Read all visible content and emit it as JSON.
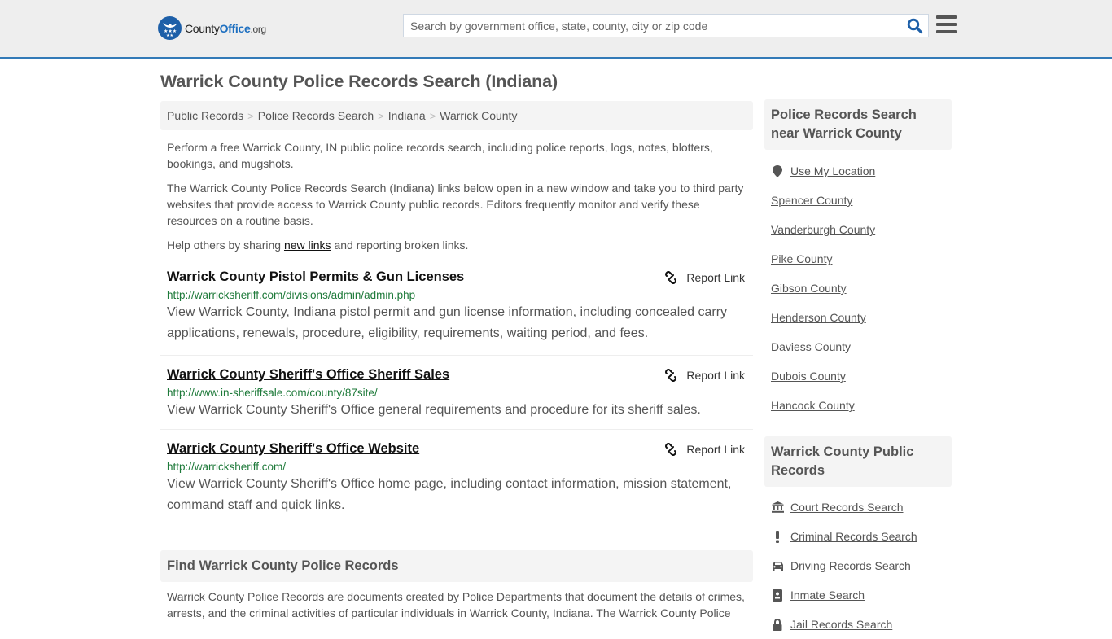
{
  "header": {
    "logo": {
      "county": "County",
      "office": "Office",
      "org": ".org",
      "icon": "eagle-stars-badge-icon"
    },
    "search": {
      "placeholder": "Search by government office, state, county, city or zip code",
      "value": "",
      "icon": "search-icon"
    },
    "menu_icon": "hamburger-menu-icon",
    "accent_color": "#337ab7"
  },
  "page": {
    "title": "Warrick County Police Records Search (Indiana)",
    "breadcrumb": [
      {
        "label": "Public Records"
      },
      {
        "label": "Police Records Search"
      },
      {
        "label": "Indiana"
      },
      {
        "label": "Warrick County"
      }
    ],
    "intro": {
      "p1": "Perform a free Warrick County, IN public police records search, including police reports, logs, notes, blotters, bookings, and mugshots.",
      "p2": "The Warrick County Police Records Search (Indiana) links below open in a new window and take you to third party websites that provide access to Warrick County public records. Editors frequently monitor and verify these resources on a routine basis.",
      "p3_before": "Help others by sharing ",
      "p3_link": "new links",
      "p3_after": " and reporting broken links."
    },
    "results": [
      {
        "title": "Warrick County Pistol Permits & Gun Licenses",
        "url": "http://warricksheriff.com/divisions/admin/admin.php",
        "description": "View Warrick County, Indiana pistol permit and gun license information, including concealed carry applications, renewals, procedure, eligibility, requirements, waiting period, and fees.",
        "report_label": "Report Link"
      },
      {
        "title": "Warrick County Sheriff's Office Sheriff Sales",
        "url": "http://www.in-sheriffsale.com/county/87site/",
        "description": "View Warrick County Sheriff's Office general requirements and procedure for its sheriff sales.",
        "report_label": "Report Link"
      },
      {
        "title": "Warrick County Sheriff's Office Website",
        "url": "http://warricksheriff.com/",
        "description": "View Warrick County Sheriff's Office home page, including contact information, mission statement, command staff and quick links.",
        "report_label": "Report Link"
      }
    ],
    "find_section": {
      "heading": "Find Warrick County Police Records",
      "text": "Warrick County Police Records are documents created by Police Departments that document the details of crimes, arrests, and the criminal activities of particular individuals in Warrick County, Indiana. The Warrick County Police"
    }
  },
  "sidebar": {
    "nearby": {
      "heading": "Police Records Search near Warrick County",
      "use_location": {
        "label": "Use My Location",
        "icon": "map-pin-icon"
      },
      "counties": [
        "Spencer County",
        "Vanderburgh County",
        "Pike County",
        "Gibson County",
        "Henderson County",
        "Daviess County",
        "Dubois County",
        "Hancock County"
      ]
    },
    "public_records": {
      "heading": "Warrick County Public Records",
      "items": [
        {
          "label": "Court Records Search",
          "icon": "courthouse-icon"
        },
        {
          "label": "Criminal Records Search",
          "icon": "exclamation-icon"
        },
        {
          "label": "Driving Records Search",
          "icon": "car-icon"
        },
        {
          "label": "Inmate Search",
          "icon": "id-badge-icon"
        },
        {
          "label": "Jail Records Search",
          "icon": "lock-icon"
        }
      ]
    }
  }
}
